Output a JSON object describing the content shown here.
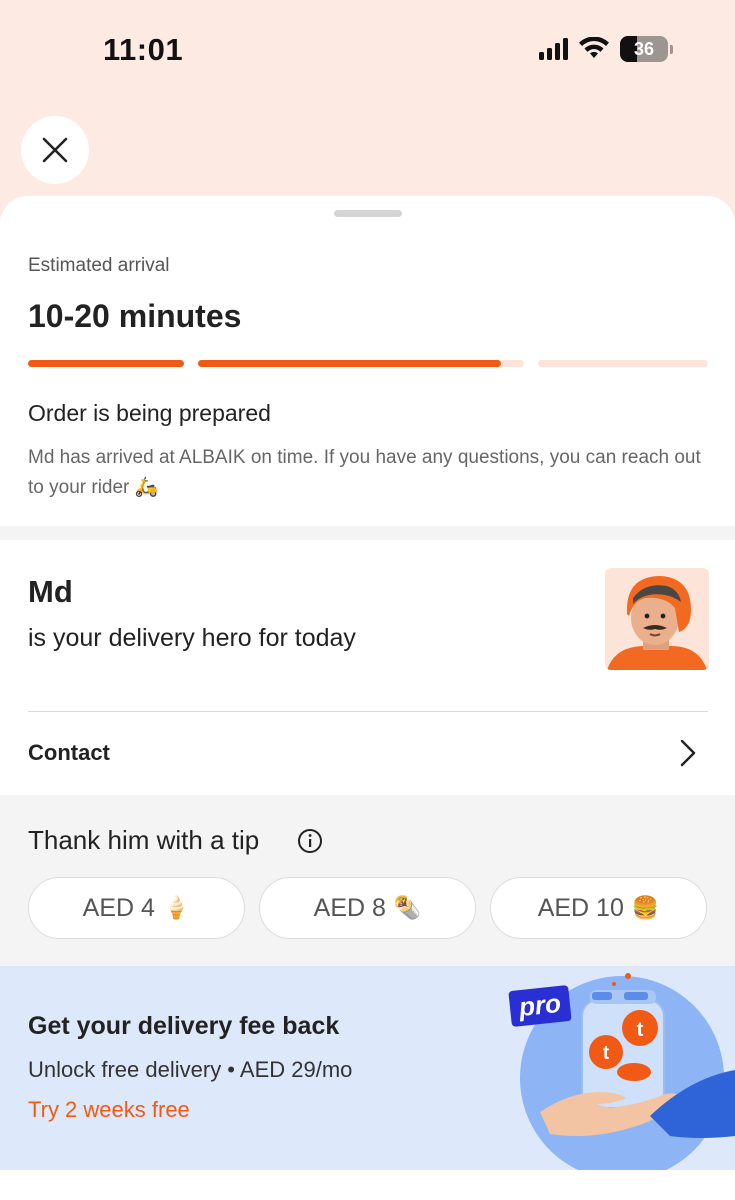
{
  "status_bar": {
    "time": "11:01",
    "battery": "36"
  },
  "estimate": {
    "label": "Estimated arrival",
    "value": "10-20 minutes"
  },
  "progress": {
    "steps": 3,
    "completed_segments": [
      1.0,
      0.93,
      0.0
    ]
  },
  "order_status": {
    "title": "Order is being prepared",
    "description": "Md has arrived at ALBAIK on time. If you have any questions, you can reach out to your rider 🛵"
  },
  "rider": {
    "name": "Md",
    "subtitle": "is your delivery hero for today"
  },
  "contact": {
    "label": "Contact"
  },
  "tip": {
    "title": "Thank him with a tip",
    "options": [
      {
        "label": "AED 4",
        "emoji": "🍦"
      },
      {
        "label": "AED 8",
        "emoji": "🌯"
      },
      {
        "label": "AED 10",
        "emoji": "🍔"
      }
    ]
  },
  "promo": {
    "title": "Get your delivery fee back",
    "subtitle": "Unlock free delivery • AED 29/mo",
    "cta": "Try 2 weeks free",
    "badge": "pro"
  },
  "colors": {
    "accent": "#f05a14",
    "header_bg": "#fdebe3",
    "promo_bg": "#dde9fb",
    "pro_badge": "#2a2fd4"
  },
  "icons": {
    "close": "close-icon",
    "chevron": "chevron-right-icon",
    "info": "info-icon"
  }
}
